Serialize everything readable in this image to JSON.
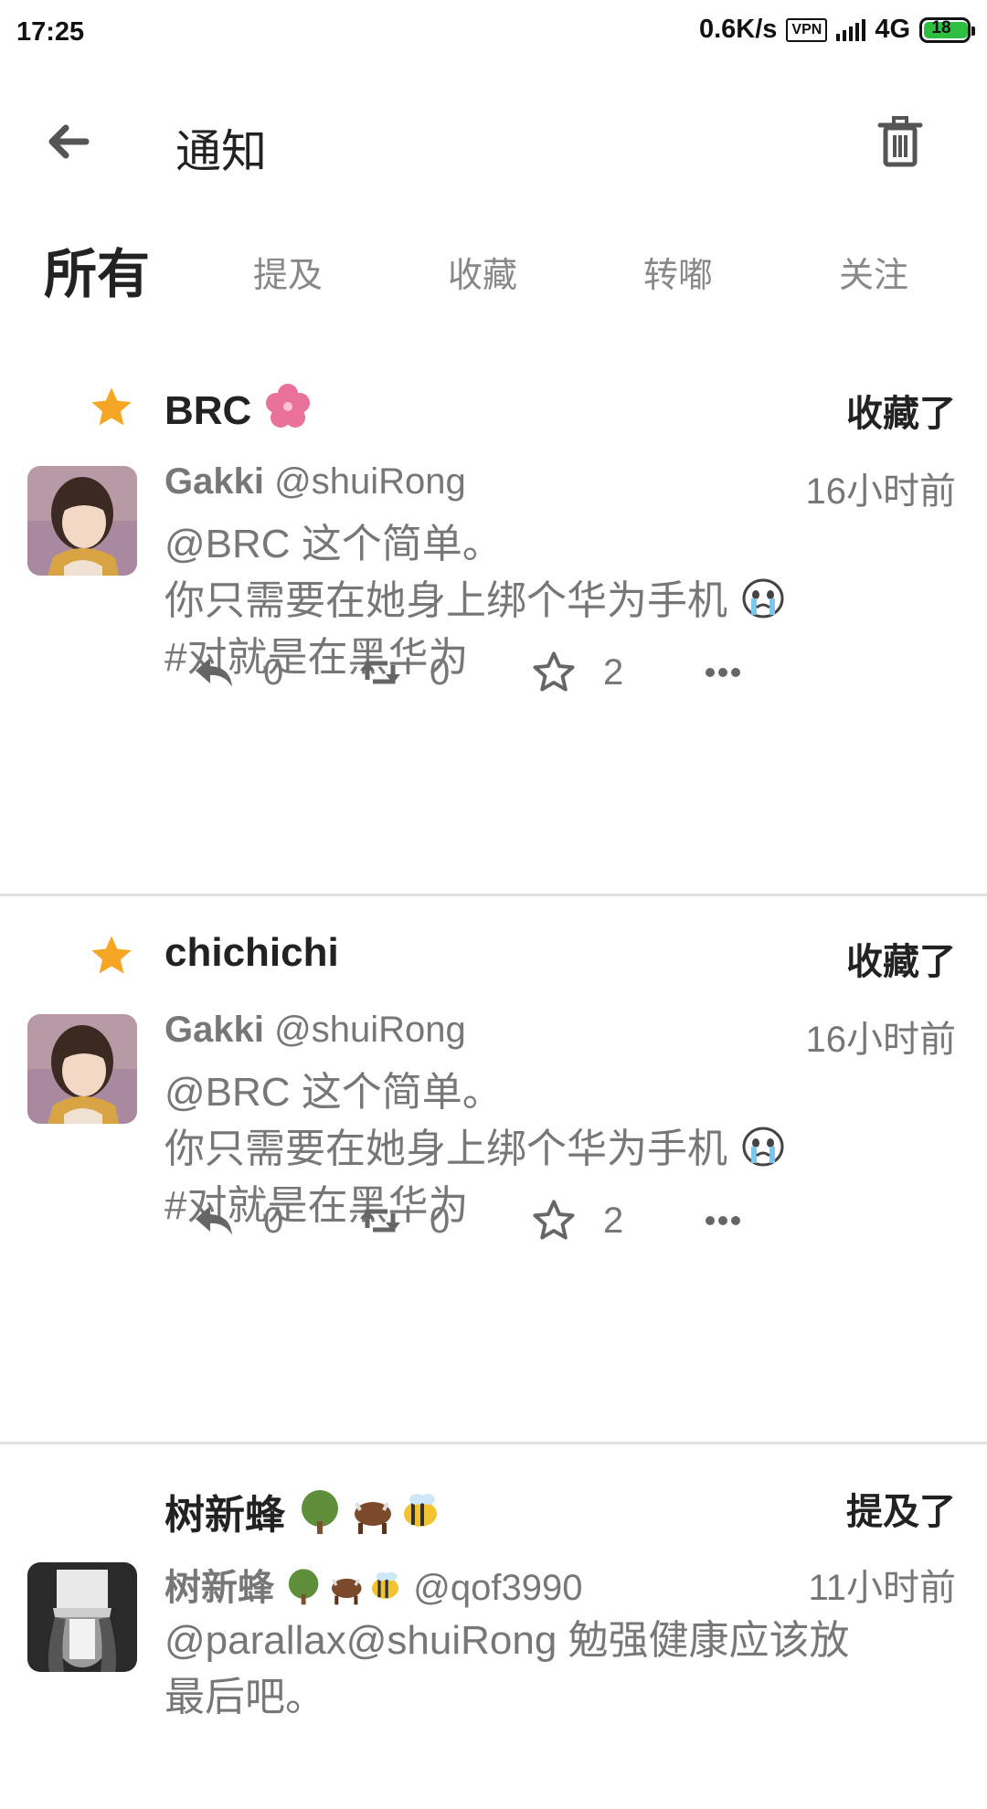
{
  "status_bar": {
    "time": "17:25",
    "net_speed": "0.6K/s",
    "vpn": "VPN",
    "network": "4G",
    "battery": "18"
  },
  "app_bar": {
    "title": "通知",
    "back_icon": "arrow-left-icon",
    "trash_icon": "trash-icon"
  },
  "tabs": [
    {
      "label": "所有",
      "active": true
    },
    {
      "label": "提及",
      "active": false
    },
    {
      "label": "收藏",
      "active": false
    },
    {
      "label": "转嘟",
      "active": false
    },
    {
      "label": "关注",
      "active": false
    }
  ],
  "notifications": [
    {
      "actor": "BRC",
      "action": "收藏了",
      "author_name": "Gakki",
      "author_handle": "@shuiRong",
      "time": "16小时前",
      "lines": [
        "@BRC 这个简单。",
        "你只需要在她身上绑个华为手机",
        "#对就是在黑华为"
      ],
      "reply_count": "0",
      "boost_count": "0",
      "fav_count": "2"
    },
    {
      "actor": "chichichi",
      "action": "收藏了",
      "author_name": "Gakki",
      "author_handle": "@shuiRong",
      "time": "16小时前",
      "lines": [
        "@BRC 这个简单。",
        "你只需要在她身上绑个华为手机",
        "#对就是在黑华为"
      ],
      "reply_count": "0",
      "boost_count": "0",
      "fav_count": "2"
    },
    {
      "actor": "树新蜂",
      "action": "提及了",
      "author_name": "树新蜂",
      "author_handle": "@qof3990",
      "time": "11小时前",
      "lines": [
        "@parallax@shuiRong 勉强健康应该放",
        "最后吧。"
      ]
    }
  ],
  "colors": {
    "star": "#f5a623",
    "text_primary": "#222222",
    "text_secondary": "#777777",
    "divider": "#e2e2e2"
  }
}
